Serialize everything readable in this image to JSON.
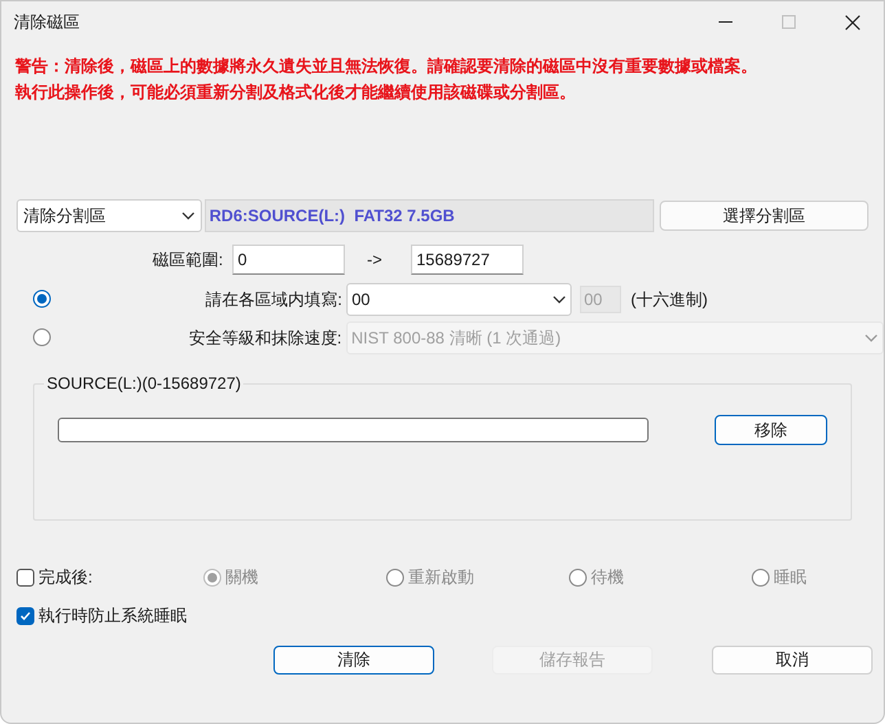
{
  "window": {
    "title": "清除磁區",
    "maximize_disabled": true
  },
  "warning": [
    "警告：清除後，磁區上的數據將永久遺失並且無法恢復。請確認要清除的磁區中沒有重要數據或檔案。",
    "執行此操作後，可能必須重新分割及格式化後才能繼續使用該磁碟或分割區。"
  ],
  "target": {
    "mode": "清除分割區",
    "partition": "RD6:SOURCE(L:)  FAT32 7.5GB",
    "select_button": "選擇分割區"
  },
  "range": {
    "label": "磁區範圍:",
    "start": "0",
    "arrow": "->",
    "end": "15689727"
  },
  "methods": [
    {
      "kind": "fill",
      "selected": true,
      "label": "請在各區域内填寫:",
      "value": "00",
      "hex": "00",
      "hex_note": "(十六進制)",
      "disabled": false
    },
    {
      "kind": "security",
      "selected": false,
      "label": "安全等級和抹除速度:",
      "value": "NIST 800-88 清晰 (1 次通過)",
      "disabled": true
    }
  ],
  "progress": {
    "title": "SOURCE(L:)(0-15689727)",
    "level": 0,
    "remove_button": "移除"
  },
  "after_complete": {
    "label": "完成後:",
    "checked": false,
    "options": [
      {
        "label": "關機",
        "selected": true
      },
      {
        "label": "重新啟動",
        "selected": false
      },
      {
        "label": "待機",
        "selected": false
      },
      {
        "label": "睡眠",
        "selected": false
      }
    ]
  },
  "prevent_sleep": {
    "label": "執行時防止系統睡眠",
    "checked": true
  },
  "buttons": [
    {
      "label": "清除",
      "disabled": false,
      "default": true
    },
    {
      "label": "儲存報告",
      "disabled": true,
      "default": false
    },
    {
      "label": "取消",
      "disabled": false,
      "default": false
    }
  ]
}
